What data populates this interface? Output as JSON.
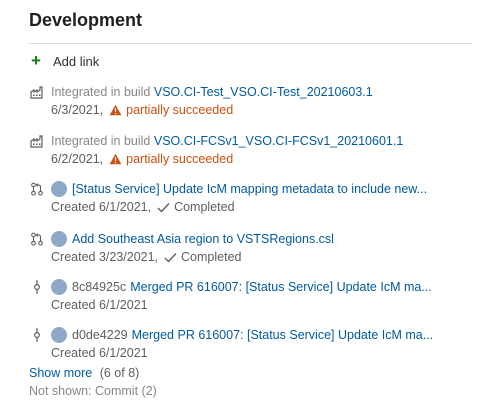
{
  "section": {
    "title": "Development",
    "add_link": "Add link"
  },
  "items": [
    {
      "type": "build",
      "prefix": "Integrated in build",
      "link": "VSO.CI-Test_VSO.CI-Test_20210603.1",
      "date": "6/3/2021,",
      "status": "partially succeeded"
    },
    {
      "type": "build",
      "prefix": "Integrated in build",
      "link": "VSO.CI-FCSv1_VSO.CI-FCSv1_20210601.1",
      "date": "6/2/2021,",
      "status": "partially succeeded"
    },
    {
      "type": "pull-request",
      "link": "[Status Service] Update IcM mapping metadata to include new...",
      "meta": "Created 6/1/2021,",
      "status": "Completed"
    },
    {
      "type": "pull-request",
      "link": "Add Southeast Asia region to VSTSRegions.csl",
      "meta": "Created 3/23/2021,",
      "status": "Completed"
    },
    {
      "type": "commit",
      "hash": "8c84925c",
      "link": "Merged PR 616007: [Status Service] Update IcM ma...",
      "meta": "Created 6/1/2021"
    },
    {
      "type": "commit",
      "hash": "d0de4229",
      "link": "Merged PR 616007: [Status Service] Update IcM ma...",
      "meta": "Created 6/1/2021"
    }
  ],
  "footer": {
    "show_more": "Show more",
    "count": "(6 of 8)",
    "not_shown": "Not shown: Commit (2)"
  },
  "colors": {
    "link": "#005a9e",
    "warning": "#ca5010",
    "add": "#107c10"
  },
  "icons": {
    "build": "build-factory-icon",
    "pull_request": "pull-request-icon",
    "commit": "commit-icon",
    "warning": "warning-triangle-icon",
    "completed": "checkmark-icon",
    "add": "plus-icon"
  }
}
